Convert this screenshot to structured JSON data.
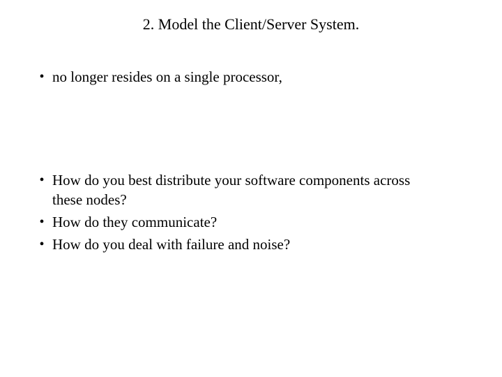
{
  "slide": {
    "title": "2. Model the Client/Server System.",
    "bullets_group1": [
      "no longer resides on a single processor,"
    ],
    "bullets_group2": [
      "How do you best distribute your software components across these nodes?",
      "How do they communicate?",
      "How do you deal with failure and noise?"
    ]
  }
}
